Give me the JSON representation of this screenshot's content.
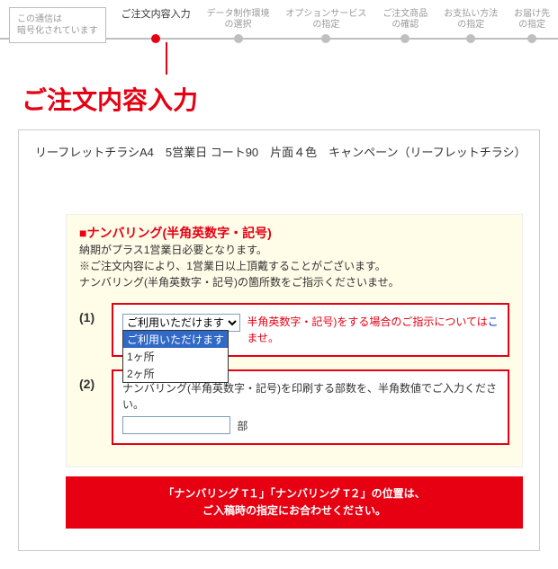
{
  "ssl_notice": "この通信は\n暗号化されています",
  "steps": [
    {
      "label": "ご注文内容入力",
      "active": true
    },
    {
      "label": "データ制作環境\nの選択"
    },
    {
      "label": "オプションサービス\nの指定"
    },
    {
      "label": "ご注文商品\nの確認"
    },
    {
      "label": "お支払い方法\nの指定"
    },
    {
      "label": "お届け先\nの指定"
    }
  ],
  "page_title": "ご注文内容入力",
  "product_line": "リーフレットチラシA4　5営業日 コート90　片面４色　キャンペーン（リーフレットチラシ）",
  "numbering": {
    "heading": "■ナンバリング(半角英数字・記号)",
    "note1": "納期がプラス1営業日必要となります。",
    "note2": "※ご注文内容により、1営業日以上頂戴することがございます。",
    "note3": "ナンバリング(半角英数字・記号)の箇所数をご指示くださいませ。",
    "field1": {
      "num": "(1)",
      "selected": "ご利用いただけます",
      "options": [
        "ご利用いただけます",
        "1ヶ所",
        "2ヶ所"
      ],
      "side_text_a": "半角英数字・記号)をする場合のご指示については",
      "side_link": "こ",
      "side_text_b": "ませ。"
    },
    "field2": {
      "num": "(2)",
      "label": "ナンバリング(半角英数字・記号)を印刷する部数を、半角数値でご入力ください。",
      "unit": "部"
    },
    "red_band": "「ナンバリング T１」「ナンバリング T２」の位置は、\nご入稿時の指定にお合わせください。"
  }
}
